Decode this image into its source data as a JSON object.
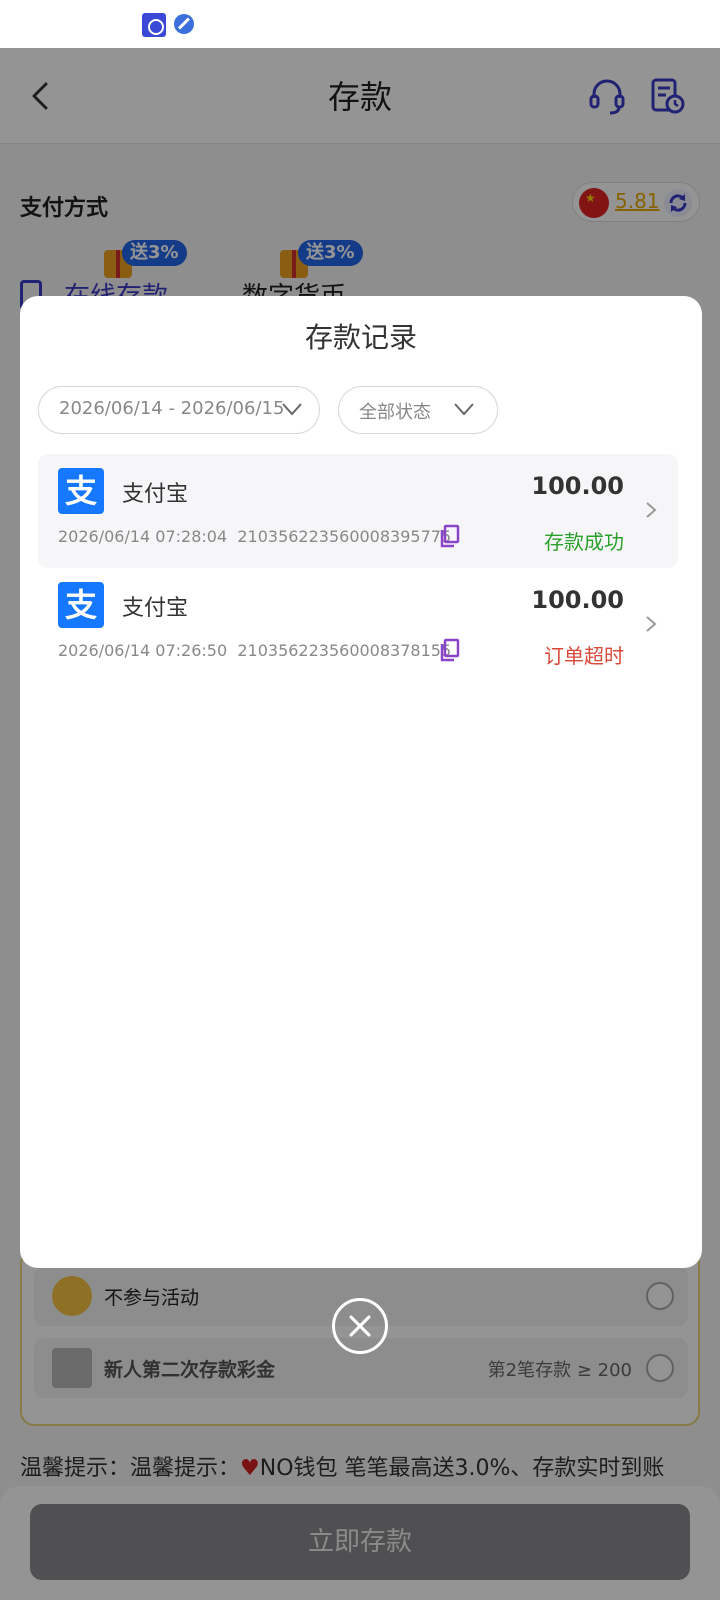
{
  "header": {
    "title": "存款"
  },
  "payment": {
    "title": "支付方式",
    "balance": "5.81",
    "methods": [
      {
        "tag": "送3%",
        "label": "在线存款"
      },
      {
        "tag": "送3%",
        "label": "数字货币"
      }
    ]
  },
  "activities": [
    {
      "label": "不参与活动",
      "condition": ""
    },
    {
      "label": "新人第二次存款彩金",
      "condition": "第2笔存款 ≥ 200"
    }
  ],
  "tip": {
    "prefix": "温馨提示：温馨提示：",
    "text": "NO钱包 笔笔最高送3.0%、存款实时到账"
  },
  "submit_label": "立即存款",
  "modal": {
    "title": "存款记录",
    "date_filter": "2026/06/14 - 2026/06/15",
    "status_filter": "全部状态",
    "records": [
      {
        "method": "支付宝",
        "icon_char": "支",
        "amount": "100.00",
        "time": "2026/06/14 07:28:04",
        "order_id": "210356223560008395775",
        "status": "存款成功"
      },
      {
        "method": "支付宝",
        "icon_char": "支",
        "amount": "100.00",
        "time": "2026/06/14 07:26:50",
        "order_id": "210356223560008378155",
        "status": "订单超时"
      }
    ]
  },
  "colors": {
    "accent": "#3b3bc8",
    "alipay": "#1677ff",
    "success": "#2ba02b",
    "timeout": "#d84a3a"
  }
}
